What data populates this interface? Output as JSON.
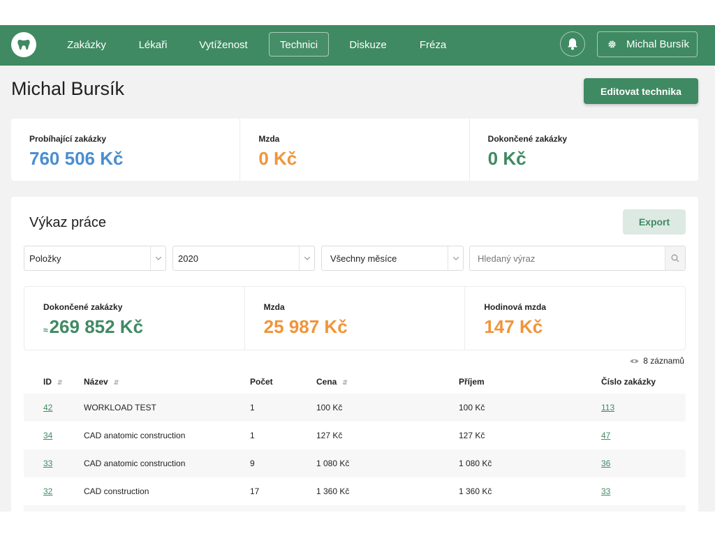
{
  "nav": {
    "items": [
      {
        "label": "Zakázky",
        "active": false
      },
      {
        "label": "Lékaři",
        "active": false
      },
      {
        "label": "Vytíženost",
        "active": false
      },
      {
        "label": "Technici",
        "active": true
      },
      {
        "label": "Diskuze",
        "active": false
      },
      {
        "label": "Fréza",
        "active": false
      }
    ],
    "user_label": "Michal Bursík",
    "logo_icon": "tooth-icon",
    "bell_icon": "bell-icon",
    "user_icon": "gear-icon"
  },
  "page": {
    "title": "Michal Bursík",
    "edit_button": "Editovat technika"
  },
  "summary": [
    {
      "label": "Probíhající zakázky",
      "value": "760 506 Kč",
      "color": "#4a8ed0"
    },
    {
      "label": "Mzda",
      "value": "0 Kč",
      "color": "#f0953a"
    },
    {
      "label": "Dokončené zakázky",
      "value": "0 Kč",
      "color": "#3f8a62"
    }
  ],
  "report": {
    "title": "Výkaz práce",
    "export_button": "Export",
    "filters": {
      "type": "Položky",
      "year": "2020",
      "month": "Všechny měsíce",
      "search_placeholder": "Hledaný výraz"
    },
    "stats": [
      {
        "label": "Dokončené zakázky",
        "prefix": "≈",
        "value": "269 852 Kč",
        "color": "#3f8a62"
      },
      {
        "label": "Mzda",
        "value": "25 987 Kč",
        "color": "#f0953a"
      },
      {
        "label": "Hodinová mzda",
        "value": "147 Kč",
        "color": "#f0953a"
      }
    ],
    "records_label": "8 záznamů",
    "columns": [
      "ID",
      "Název",
      "Počet",
      "Cena",
      "Příjem",
      "Číslo zakázky"
    ],
    "rows": [
      {
        "id": "42",
        "name": "WORKLOAD TEST",
        "count": "1",
        "price": "100 Kč",
        "income": "100 Kč",
        "order": "113"
      },
      {
        "id": "34",
        "name": "CAD anatomic construction",
        "count": "1",
        "price": "127 Kč",
        "income": "127 Kč",
        "order": "47"
      },
      {
        "id": "33",
        "name": "CAD anatomic construction",
        "count": "9",
        "price": "1 080 Kč",
        "income": "1 080 Kč",
        "order": "36"
      },
      {
        "id": "32",
        "name": "CAD construction",
        "count": "17",
        "price": "1 360 Kč",
        "income": "1 360 Kč",
        "order": "33"
      }
    ]
  },
  "colors": {
    "brand": "#3f8a62",
    "blue": "#4a8ed0",
    "orange": "#f0953a"
  }
}
